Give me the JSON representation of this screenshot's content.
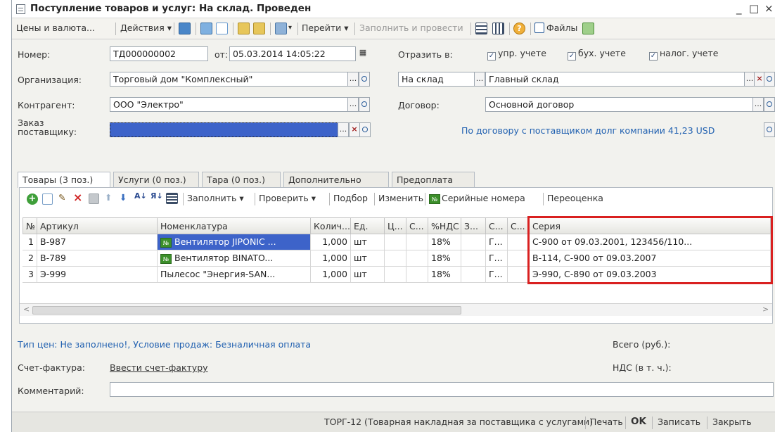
{
  "window": {
    "title": "Поступление товаров и услуг: На склад. Проведен",
    "controls": {
      "minimize": "_",
      "maximize": "□",
      "close": "×"
    }
  },
  "toolbar": {
    "prices": "Цены и валюта...",
    "actions": "Действия ▾",
    "go": "Перейти ▾",
    "fill_post": "Заполнить и провести",
    "help": "?",
    "files": "Файлы"
  },
  "header": {
    "number_label": "Номер:",
    "number_value": "ТД000000002",
    "from_label": "от:",
    "date_value": "05.03.2014 14:05:22",
    "reflect_label": "Отразить в:",
    "check_mgmt": "упр. учете",
    "check_acc": "бух. учете",
    "check_tax": "налог. учете",
    "org_label": "Организация:",
    "org_value": "Торговый дом \"Комплексный\"",
    "dest_type": "На склад",
    "warehouse_value": "Главный склад",
    "counterparty_label": "Контрагент:",
    "counterparty_value": "ООО \"Электро\"",
    "contract_label": "Договор:",
    "contract_value": "Основной договор",
    "order_label_1": "Заказ",
    "order_label_2": "поставщику:",
    "debt_text": "По договору с поставщиком долг компании 41,23 USD"
  },
  "tabs": [
    {
      "label": "Товары (3 поз.)"
    },
    {
      "label": "Услуги (0 поз.)"
    },
    {
      "label": "Тара (0 поз.)"
    },
    {
      "label": "Дополнительно"
    },
    {
      "label": "Предоплата"
    }
  ],
  "grid_toolbar": {
    "fill": "Заполнить ▾",
    "check": "Проверить ▾",
    "select": "Подбор",
    "change": "Изменить",
    "serials": "Серийные номера",
    "revalue": "Переоценка",
    "badge": "№"
  },
  "grid": {
    "columns": [
      "№",
      "Артикул",
      "Номенклатура",
      "Колич...",
      "Ед.",
      "Ц...",
      "С...",
      "%НДС",
      "З...",
      "С...",
      "С...",
      "Серия"
    ],
    "rows": [
      {
        "n": "1",
        "article": "В-987",
        "badge": "№",
        "name": "Вентилятор JIPONIC ...",
        "qty": "1,000",
        "unit": "шт",
        "vat": "18%",
        "s": "Г...",
        "series": "С-900 от 09.03.2001, 123456/110..."
      },
      {
        "n": "2",
        "article": "В-789",
        "badge": "№",
        "name": "Вентилятор BINATO...",
        "qty": "1,000",
        "unit": "шт",
        "vat": "18%",
        "s": "Г...",
        "series": "В-114, С-900 от 09.03.2007"
      },
      {
        "n": "3",
        "article": "Э-999",
        "badge": "",
        "name": "Пылесос \"Энергия-SAN...",
        "qty": "1,000",
        "unit": "шт",
        "vat": "18%",
        "s": "Г...",
        "series": "Э-990, С-890 от 09.03.2003"
      }
    ],
    "scroll_left": "<",
    "scroll_right": ">"
  },
  "footer": {
    "price_info": "Тип цен: Не заполнено!, Условие продаж: Безналичная оплата",
    "total_label": "Всего (руб.):",
    "invoice_label": "Счет-фактура:",
    "invoice_link": "Ввести счет-фактуру",
    "vat_label": "НДС (в т. ч.):",
    "comment_label": "Комментарий:"
  },
  "bottom": {
    "torg": "ТОРГ-12 (Товарная накладная за поставщика с услугами)",
    "print": "Печать",
    "ok": "OK",
    "save": "Записать",
    "close": "Закрыть"
  },
  "colors": {
    "accent": "#2060b0",
    "highlight": "#d92020",
    "selection": "#3d63c9"
  }
}
